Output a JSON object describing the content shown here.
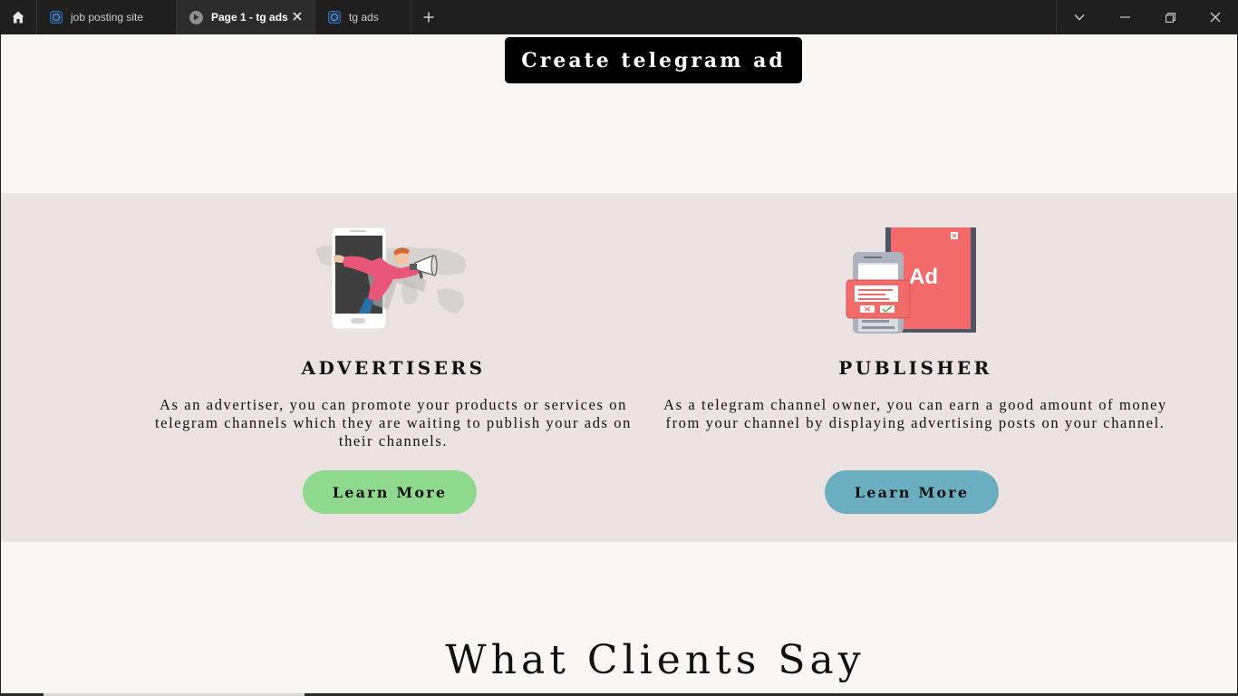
{
  "browser": {
    "tabs": [
      {
        "label": "job posting site",
        "active": false
      },
      {
        "label": "Page 1 - tg ads",
        "active": true
      },
      {
        "label": "tg ads",
        "active": false
      }
    ],
    "icons": {
      "home": "home-icon",
      "new_tab": "plus-icon",
      "tab_list": "chevron-down-icon",
      "minimize": "minimize-icon",
      "restore": "restore-icon",
      "close": "close-icon"
    }
  },
  "page": {
    "create_button": "Create telegram ad",
    "features": [
      {
        "title": "ADVERTISERS",
        "description": "As an advertiser, you can promote your products or services on telegram channels which they are waiting to publish your ads on their channels.",
        "button": "Learn More",
        "button_color": "#8fd98f"
      },
      {
        "title": "PUBLISHER",
        "description": "As a telegram channel owner, you can earn a good amount of money from your channel by displaying advertising posts on your channel.",
        "button": "Learn More",
        "button_color": "#6baec0"
      }
    ],
    "publisher_illustration_text": "Ad",
    "clients_heading": "What Clients Say"
  },
  "colors": {
    "page_bg": "#faf6f4",
    "section_bg": "#ebe2e1",
    "ad_red": "#f36a6a"
  }
}
